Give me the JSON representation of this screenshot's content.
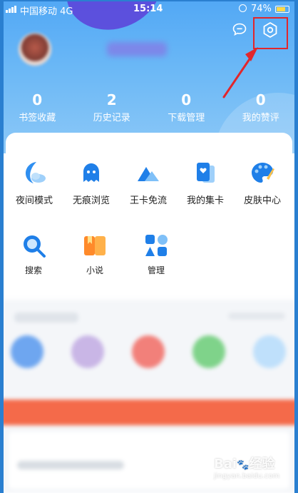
{
  "status_bar": {
    "carrier": "中国移动",
    "network": "4G",
    "time": "15:14",
    "battery": "74%",
    "battery_level": 0.74
  },
  "stats": [
    {
      "count": "0",
      "label": "书签收藏"
    },
    {
      "count": "2",
      "label": "历史记录"
    },
    {
      "count": "0",
      "label": "下载管理"
    },
    {
      "count": "0",
      "label": "我的赞评"
    }
  ],
  "tools_row1": [
    {
      "label": "夜间模式",
      "icon": "moon-icon"
    },
    {
      "label": "无痕浏览",
      "icon": "ghost-icon"
    },
    {
      "label": "王卡免流",
      "icon": "mountain-icon"
    },
    {
      "label": "我的集卡",
      "icon": "card-icon"
    },
    {
      "label": "皮肤中心",
      "icon": "palette-icon"
    }
  ],
  "tools_row2": [
    {
      "label": "搜索",
      "icon": "search-icon"
    },
    {
      "label": "小说",
      "icon": "book-icon"
    },
    {
      "label": "管理",
      "icon": "grid-icon"
    }
  ],
  "watermark": {
    "brand": "Bai",
    "brand2": "经验",
    "url": "jingyan.baidu.com"
  },
  "colors": {
    "header_top": "#52a8f5",
    "header_bottom": "#8cc8f7",
    "highlight": "#e2262b"
  }
}
